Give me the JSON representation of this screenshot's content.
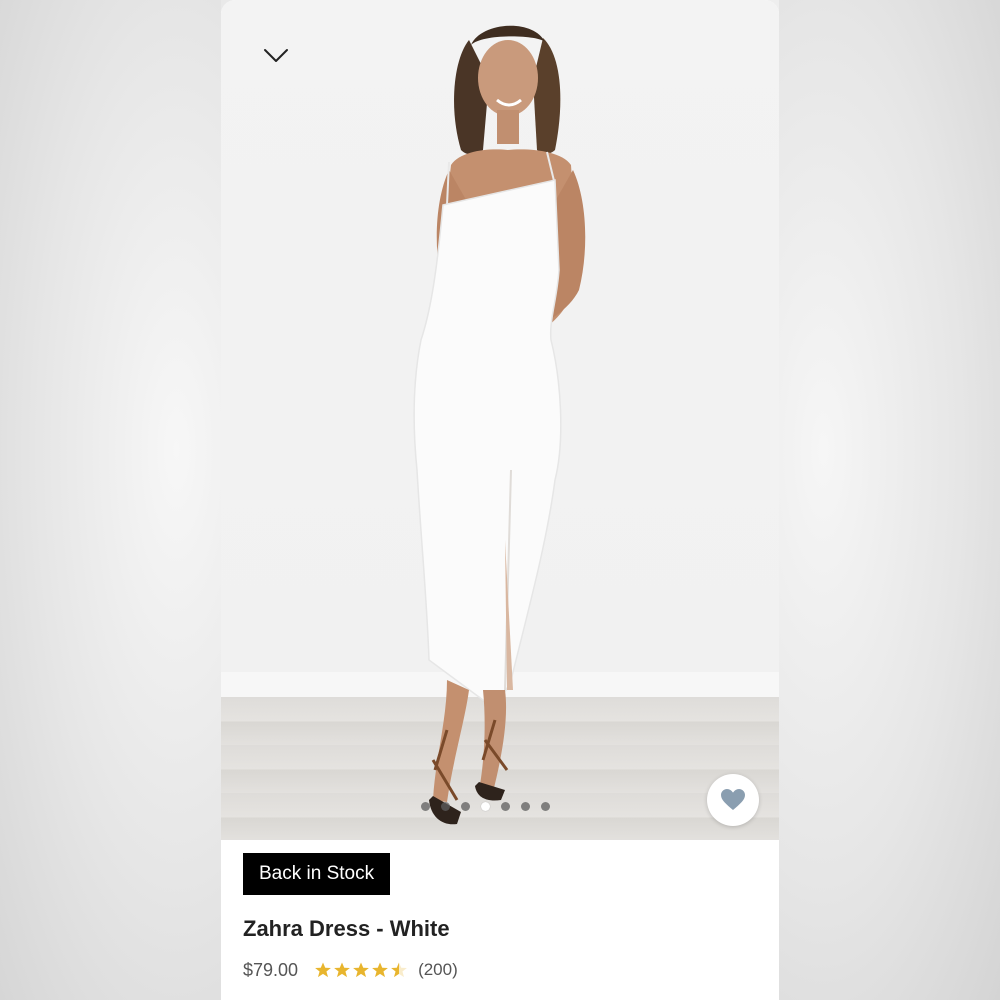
{
  "product": {
    "badge": "Back in Stock",
    "title": "Zahra Dress - White",
    "price": "$79.00",
    "rating": 4.5,
    "rating_max": 5,
    "review_count": "(200)"
  },
  "gallery": {
    "total_images": 7,
    "active_index": 3
  },
  "icons": {
    "close": "chevron-down-icon",
    "wishlist": "heart-icon",
    "rating": "star-icon"
  },
  "colors": {
    "badge_bg": "#000000",
    "badge_text": "#ffffff",
    "star": "#e8b52e",
    "heart": "#8a9eb0"
  }
}
